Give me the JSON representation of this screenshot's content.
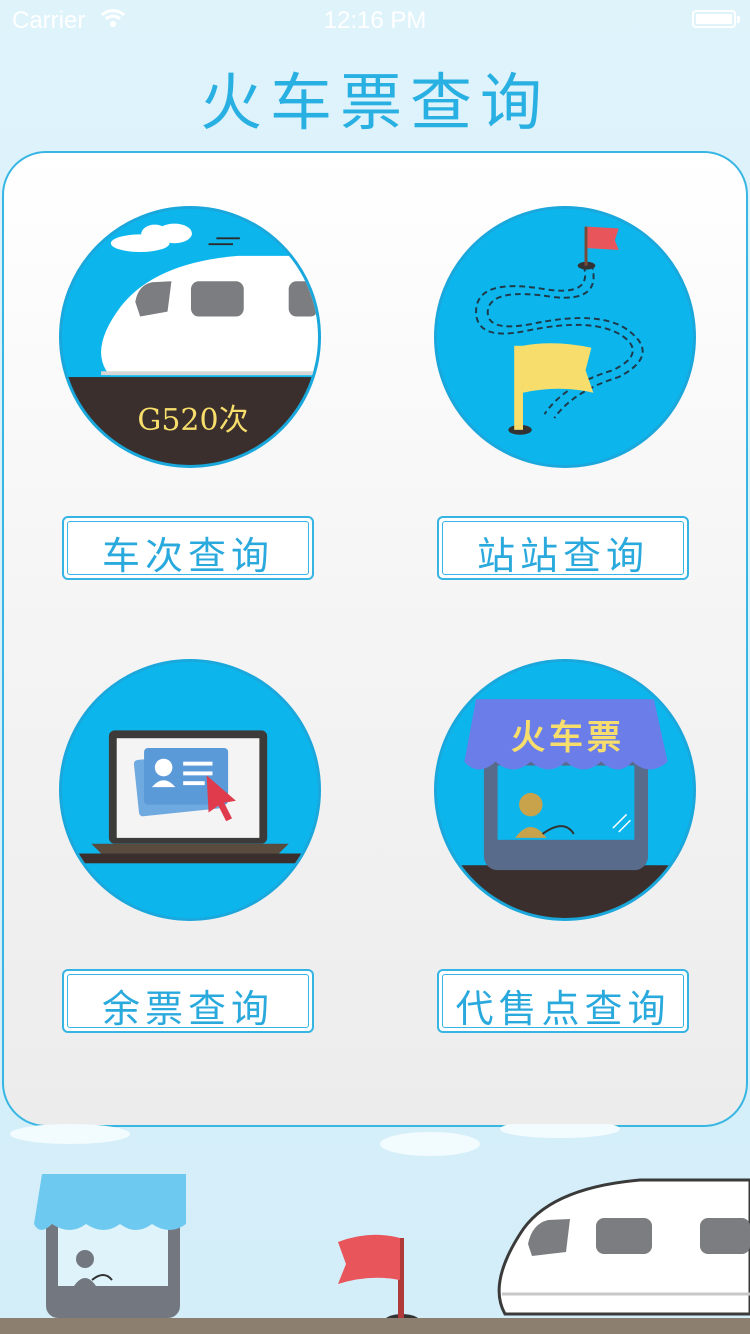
{
  "status_bar": {
    "carrier": "Carrier",
    "time": "12:16 PM"
  },
  "header": {
    "title": "火车票查询"
  },
  "menu": {
    "train_badge": "G520次",
    "booth_sign": "火车票",
    "items": [
      {
        "label": "车次查询",
        "icon": "high-speed-train-icon"
      },
      {
        "label": "站站查询",
        "icon": "route-flags-icon"
      },
      {
        "label": "余票查询",
        "icon": "laptop-ticket-icon"
      },
      {
        "label": "代售点查询",
        "icon": "ticket-booth-icon"
      }
    ]
  },
  "colors": {
    "accent": "#29b0e3",
    "circle": "#0cb6ec",
    "ground": "#3a2f2d",
    "flag_yellow": "#f7de6c",
    "flag_red": "#e8555a"
  }
}
